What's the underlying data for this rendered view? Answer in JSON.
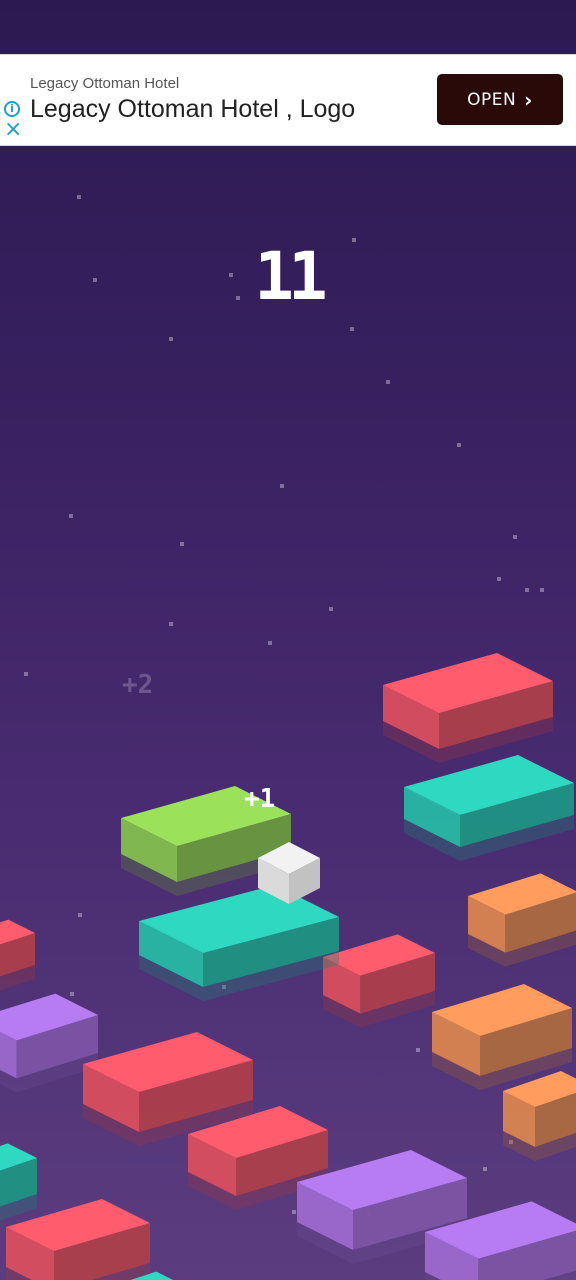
{
  "ad": {
    "advertiser": "Legacy Ottoman Hotel",
    "headline": "Legacy Ottoman Hotel , Logo",
    "cta_label": "OPEN",
    "info_icon": "info-icon",
    "close_icon": "close-icon"
  },
  "game": {
    "score": "11",
    "bonus_current": "+1",
    "bonus_previous": "+2"
  },
  "colors": {
    "red": "#ff5c6e",
    "teal": "#2ed8c1",
    "green": "#9be15a",
    "orange": "#ff9c5e",
    "purple": "#b77cf2",
    "cube": "#f2f2f2"
  }
}
